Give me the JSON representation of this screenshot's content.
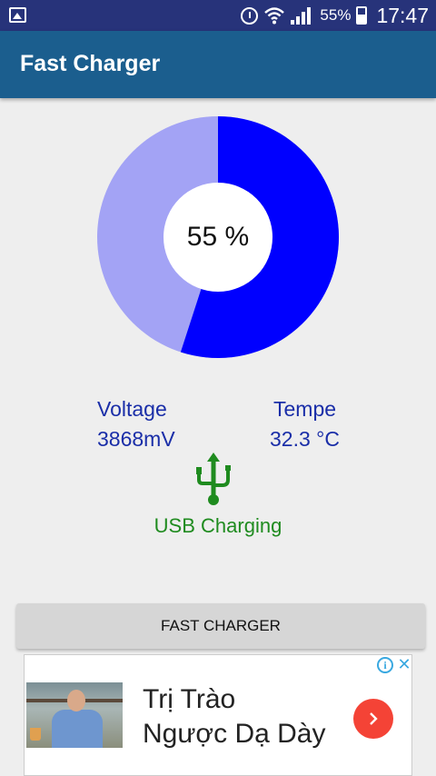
{
  "status_bar": {
    "battery_percent": "55%",
    "time": "17:47",
    "icons": [
      "image-notification-icon",
      "alarm-icon",
      "wifi-icon",
      "signal-icon",
      "battery-charging-icon"
    ]
  },
  "app_bar": {
    "title": "Fast Charger"
  },
  "battery_chart": {
    "type": "donut",
    "level_fraction": 0.55,
    "label": "55 %",
    "colors": {
      "charged": "#0000ff",
      "remaining": "#a3a3f5",
      "center": "#ffffff"
    }
  },
  "stats": {
    "voltage_label": "Voltage",
    "voltage_value": "3868mV",
    "temp_label": "Tempe",
    "temp_value": "32.3 °C"
  },
  "charging": {
    "icon": "usb-icon",
    "status": "USB Charging",
    "color": "#1f8b1f"
  },
  "button": {
    "label": "FAST CHARGER"
  },
  "ad": {
    "line1": "Trị Trào",
    "line2": "Ngược Dạ Dày",
    "info_icon": "info-icon",
    "close_icon": "close-icon",
    "arrow_icon": "chevron-right-icon",
    "accent": "#f44336"
  }
}
